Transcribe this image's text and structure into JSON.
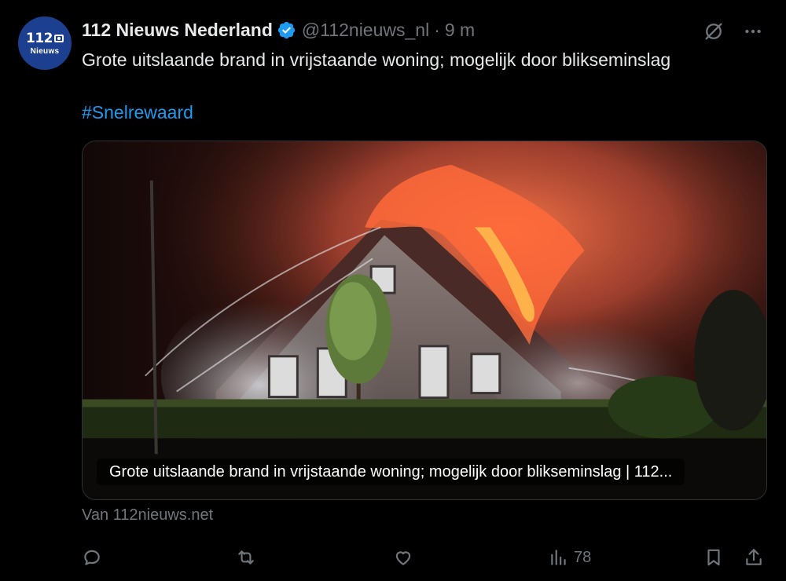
{
  "account": {
    "display_name": "112 Nieuws Nederland",
    "handle": "@112nieuws_nl",
    "separator": "·",
    "time": "9 m",
    "avatar_logo": "112",
    "avatar_sub": "Nieuws"
  },
  "tweet": {
    "text": "Grote uitslaande brand in vrijstaande woning; mogelijk door blikseminslag",
    "hashtag": "#Snelrewaard"
  },
  "card": {
    "caption": "Grote uitslaande brand in vrijstaande woning; mogelijk door blikseminslag | 112...",
    "source": "Van 112nieuws.net"
  },
  "actions": {
    "views": "78"
  },
  "colors": {
    "background": "#000000",
    "text": "#e7e9ea",
    "muted": "#71767b",
    "link": "#1d9bf0",
    "verified": "#1d9bf0",
    "avatar_bg": "#1d3f8f"
  },
  "icons": [
    "verified-badge-icon",
    "grok-icon",
    "more-icon",
    "reply-icon",
    "repost-icon",
    "like-icon",
    "views-icon",
    "bookmark-icon",
    "share-icon"
  ]
}
